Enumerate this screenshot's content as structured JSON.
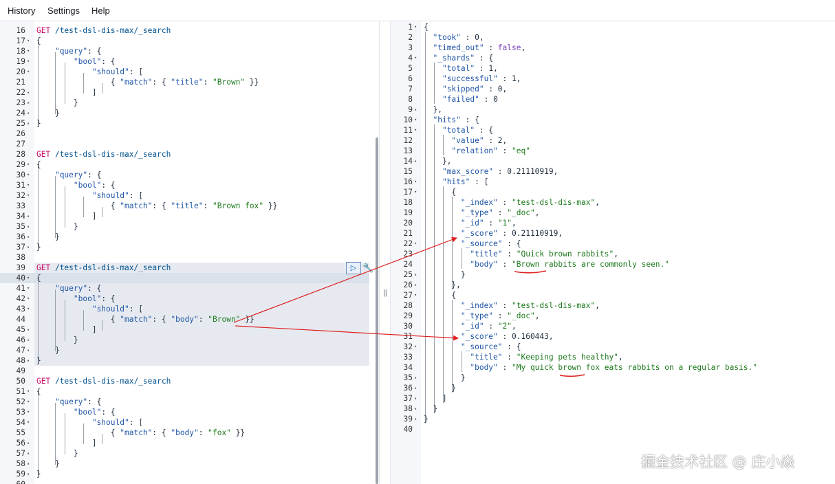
{
  "menu": [
    "History",
    "Settings",
    "Help"
  ],
  "request_lines": [
    [
      16,
      "",
      [
        [
          "GET ",
          "method"
        ],
        [
          "/test-dsl-dis-max/_search",
          "url"
        ]
      ]
    ],
    [
      17,
      "▾",
      [
        [
          "{",
          "punc"
        ]
      ]
    ],
    [
      18,
      "▾",
      [
        [
          "    ",
          "punc"
        ],
        [
          "\"query\"",
          "key"
        ],
        [
          ": {",
          "punc"
        ]
      ]
    ],
    [
      19,
      "▾",
      [
        [
          "        ",
          "punc"
        ],
        [
          "\"bool\"",
          "key"
        ],
        [
          ": {",
          "punc"
        ]
      ]
    ],
    [
      20,
      "▾",
      [
        [
          "            ",
          "punc"
        ],
        [
          "\"should\"",
          "key"
        ],
        [
          ": [",
          "punc"
        ]
      ]
    ],
    [
      21,
      "",
      [
        [
          "                { ",
          "punc"
        ],
        [
          "\"match\"",
          "key"
        ],
        [
          ": { ",
          "punc"
        ],
        [
          "\"title\"",
          "key"
        ],
        [
          ": ",
          "punc"
        ],
        [
          "\"Brown\"",
          "str"
        ],
        [
          " }}",
          "punc"
        ]
      ]
    ],
    [
      22,
      "▴",
      [
        [
          "            ]",
          "punc"
        ]
      ]
    ],
    [
      23,
      "▴",
      [
        [
          "        }",
          "punc"
        ]
      ]
    ],
    [
      24,
      "▴",
      [
        [
          "    }",
          "punc"
        ]
      ]
    ],
    [
      25,
      "▴",
      [
        [
          "}",
          "punc"
        ]
      ]
    ],
    [
      26,
      "",
      []
    ],
    [
      27,
      "",
      []
    ],
    [
      28,
      "",
      [
        [
          "GET ",
          "method"
        ],
        [
          "/test-dsl-dis-max/_search",
          "url"
        ]
      ]
    ],
    [
      29,
      "▾",
      [
        [
          "{",
          "punc"
        ]
      ]
    ],
    [
      30,
      "▾",
      [
        [
          "    ",
          "punc"
        ],
        [
          "\"query\"",
          "key"
        ],
        [
          ": {",
          "punc"
        ]
      ]
    ],
    [
      31,
      "▾",
      [
        [
          "        ",
          "punc"
        ],
        [
          "\"bool\"",
          "key"
        ],
        [
          ": {",
          "punc"
        ]
      ]
    ],
    [
      32,
      "▾",
      [
        [
          "            ",
          "punc"
        ],
        [
          "\"should\"",
          "key"
        ],
        [
          ": [",
          "punc"
        ]
      ]
    ],
    [
      33,
      "",
      [
        [
          "                { ",
          "punc"
        ],
        [
          "\"match\"",
          "key"
        ],
        [
          ": { ",
          "punc"
        ],
        [
          "\"title\"",
          "key"
        ],
        [
          ": ",
          "punc"
        ],
        [
          "\"Brown fox\"",
          "str"
        ],
        [
          " }}",
          "punc"
        ]
      ]
    ],
    [
      34,
      "▴",
      [
        [
          "            ]",
          "punc"
        ]
      ]
    ],
    [
      35,
      "▴",
      [
        [
          "        }",
          "punc"
        ]
      ]
    ],
    [
      36,
      "▴",
      [
        [
          "    }",
          "punc"
        ]
      ]
    ],
    [
      37,
      "▴",
      [
        [
          "}",
          "punc"
        ]
      ]
    ],
    [
      38,
      "",
      []
    ],
    [
      39,
      "",
      [
        [
          "GET ",
          "method"
        ],
        [
          "/test-dsl-dis-max/_search",
          "url"
        ]
      ]
    ],
    [
      40,
      "▾",
      [
        [
          "{",
          "punc"
        ]
      ]
    ],
    [
      41,
      "▾",
      [
        [
          "    ",
          "punc"
        ],
        [
          "\"query\"",
          "key"
        ],
        [
          ": {",
          "punc"
        ]
      ]
    ],
    [
      42,
      "▾",
      [
        [
          "        ",
          "punc"
        ],
        [
          "\"bool\"",
          "key"
        ],
        [
          ": {",
          "punc"
        ]
      ]
    ],
    [
      43,
      "▾",
      [
        [
          "            ",
          "punc"
        ],
        [
          "\"should\"",
          "key"
        ],
        [
          ": [",
          "punc"
        ]
      ]
    ],
    [
      44,
      "",
      [
        [
          "                { ",
          "punc"
        ],
        [
          "\"match\"",
          "key"
        ],
        [
          ": { ",
          "punc"
        ],
        [
          "\"body\"",
          "key"
        ],
        [
          ": ",
          "punc"
        ],
        [
          "\"Brown\"",
          "str"
        ],
        [
          " }}",
          "punc"
        ]
      ]
    ],
    [
      45,
      "▴",
      [
        [
          "            ]",
          "punc"
        ]
      ]
    ],
    [
      46,
      "▴",
      [
        [
          "        }",
          "punc"
        ]
      ]
    ],
    [
      47,
      "▴",
      [
        [
          "    }",
          "punc"
        ]
      ]
    ],
    [
      48,
      "▴",
      [
        [
          "}",
          "punc"
        ]
      ]
    ],
    [
      49,
      "",
      []
    ],
    [
      50,
      "",
      [
        [
          "GET ",
          "method"
        ],
        [
          "/test-dsl-dis-max/_search",
          "url"
        ]
      ]
    ],
    [
      51,
      "▾",
      [
        [
          "{",
          "punc"
        ]
      ]
    ],
    [
      52,
      "▾",
      [
        [
          "    ",
          "punc"
        ],
        [
          "\"query\"",
          "key"
        ],
        [
          ": {",
          "punc"
        ]
      ]
    ],
    [
      53,
      "▾",
      [
        [
          "        ",
          "punc"
        ],
        [
          "\"bool\"",
          "key"
        ],
        [
          ": {",
          "punc"
        ]
      ]
    ],
    [
      54,
      "▾",
      [
        [
          "            ",
          "punc"
        ],
        [
          "\"should\"",
          "key"
        ],
        [
          ": [",
          "punc"
        ]
      ]
    ],
    [
      55,
      "",
      [
        [
          "                { ",
          "punc"
        ],
        [
          "\"match\"",
          "key"
        ],
        [
          ": { ",
          "punc"
        ],
        [
          "\"body\"",
          "key"
        ],
        [
          ": ",
          "punc"
        ],
        [
          "\"fox\"",
          "str"
        ],
        [
          " }}",
          "punc"
        ]
      ]
    ],
    [
      56,
      "▴",
      [
        [
          "            ]",
          "punc"
        ]
      ]
    ],
    [
      57,
      "▴",
      [
        [
          "        }",
          "punc"
        ]
      ]
    ],
    [
      58,
      "▴",
      [
        [
          "    }",
          "punc"
        ]
      ]
    ],
    [
      59,
      "▴",
      [
        [
          "}",
          "punc"
        ]
      ]
    ],
    [
      60,
      "",
      []
    ]
  ],
  "response_lines": [
    [
      1,
      "▾",
      [
        [
          "{",
          "punc"
        ]
      ]
    ],
    [
      2,
      "",
      [
        [
          "  ",
          "punc"
        ],
        [
          "\"took\"",
          "key"
        ],
        [
          " : ",
          "punc"
        ],
        [
          "0",
          "num"
        ],
        [
          ",",
          "punc"
        ]
      ]
    ],
    [
      3,
      "",
      [
        [
          "  ",
          "punc"
        ],
        [
          "\"timed_out\"",
          "key"
        ],
        [
          " : ",
          "punc"
        ],
        [
          "false",
          "bool"
        ],
        [
          ",",
          "punc"
        ]
      ]
    ],
    [
      4,
      "▾",
      [
        [
          "  ",
          "punc"
        ],
        [
          "\"_shards\"",
          "key"
        ],
        [
          " : {",
          "punc"
        ]
      ]
    ],
    [
      5,
      "",
      [
        [
          "    ",
          "punc"
        ],
        [
          "\"total\"",
          "key"
        ],
        [
          " : ",
          "punc"
        ],
        [
          "1",
          "num"
        ],
        [
          ",",
          "punc"
        ]
      ]
    ],
    [
      6,
      "",
      [
        [
          "    ",
          "punc"
        ],
        [
          "\"successful\"",
          "key"
        ],
        [
          " : ",
          "punc"
        ],
        [
          "1",
          "num"
        ],
        [
          ",",
          "punc"
        ]
      ]
    ],
    [
      7,
      "",
      [
        [
          "    ",
          "punc"
        ],
        [
          "\"skipped\"",
          "key"
        ],
        [
          " : ",
          "punc"
        ],
        [
          "0",
          "num"
        ],
        [
          ",",
          "punc"
        ]
      ]
    ],
    [
      8,
      "",
      [
        [
          "    ",
          "punc"
        ],
        [
          "\"failed\"",
          "key"
        ],
        [
          " : ",
          "punc"
        ],
        [
          "0",
          "num"
        ]
      ]
    ],
    [
      9,
      "▴",
      [
        [
          "  },",
          "punc"
        ]
      ]
    ],
    [
      10,
      "▾",
      [
        [
          "  ",
          "punc"
        ],
        [
          "\"hits\"",
          "key"
        ],
        [
          " : {",
          "punc"
        ]
      ]
    ],
    [
      11,
      "▾",
      [
        [
          "    ",
          "punc"
        ],
        [
          "\"total\"",
          "key"
        ],
        [
          " : {",
          "punc"
        ]
      ]
    ],
    [
      12,
      "",
      [
        [
          "      ",
          "punc"
        ],
        [
          "\"value\"",
          "key"
        ],
        [
          " : ",
          "punc"
        ],
        [
          "2",
          "num"
        ],
        [
          ",",
          "punc"
        ]
      ]
    ],
    [
      13,
      "",
      [
        [
          "      ",
          "punc"
        ],
        [
          "\"relation\"",
          "key"
        ],
        [
          " : ",
          "punc"
        ],
        [
          "\"eq\"",
          "str"
        ]
      ]
    ],
    [
      14,
      "▴",
      [
        [
          "    },",
          "punc"
        ]
      ]
    ],
    [
      15,
      "",
      [
        [
          "    ",
          "punc"
        ],
        [
          "\"max_score\"",
          "key"
        ],
        [
          " : ",
          "punc"
        ],
        [
          "0.21110919",
          "num"
        ],
        [
          ",",
          "punc"
        ]
      ]
    ],
    [
      16,
      "▾",
      [
        [
          "    ",
          "punc"
        ],
        [
          "\"hits\"",
          "key"
        ],
        [
          " : [",
          "punc"
        ]
      ]
    ],
    [
      17,
      "▾",
      [
        [
          "      {",
          "punc"
        ]
      ]
    ],
    [
      18,
      "",
      [
        [
          "        ",
          "punc"
        ],
        [
          "\"_index\"",
          "key"
        ],
        [
          " : ",
          "punc"
        ],
        [
          "\"test-dsl-dis-max\"",
          "str"
        ],
        [
          ",",
          "punc"
        ]
      ]
    ],
    [
      19,
      "",
      [
        [
          "        ",
          "punc"
        ],
        [
          "\"_type\"",
          "key"
        ],
        [
          " : ",
          "punc"
        ],
        [
          "\"_doc\"",
          "str"
        ],
        [
          ",",
          "punc"
        ]
      ]
    ],
    [
      20,
      "",
      [
        [
          "        ",
          "punc"
        ],
        [
          "\"_id\"",
          "key"
        ],
        [
          " : ",
          "punc"
        ],
        [
          "\"1\"",
          "str"
        ],
        [
          ",",
          "punc"
        ]
      ]
    ],
    [
      21,
      "",
      [
        [
          "        ",
          "punc"
        ],
        [
          "\"_score\"",
          "key"
        ],
        [
          " : ",
          "punc"
        ],
        [
          "0.21110919",
          "num"
        ],
        [
          ",",
          "punc"
        ]
      ]
    ],
    [
      22,
      "▾",
      [
        [
          "        ",
          "punc"
        ],
        [
          "\"_source\"",
          "key"
        ],
        [
          " : {",
          "punc"
        ]
      ]
    ],
    [
      23,
      "",
      [
        [
          "          ",
          "punc"
        ],
        [
          "\"title\"",
          "key"
        ],
        [
          " : ",
          "punc"
        ],
        [
          "\"Quick brown rabbits\"",
          "str"
        ],
        [
          ",",
          "punc"
        ]
      ]
    ],
    [
      24,
      "",
      [
        [
          "          ",
          "punc"
        ],
        [
          "\"body\"",
          "key"
        ],
        [
          " : ",
          "punc"
        ],
        [
          "\"Brown rabbits are commonly seen.\"",
          "str"
        ]
      ]
    ],
    [
      25,
      "▴",
      [
        [
          "        }",
          "punc"
        ]
      ]
    ],
    [
      26,
      "▴",
      [
        [
          "      },",
          "punc"
        ]
      ]
    ],
    [
      27,
      "▾",
      [
        [
          "      {",
          "punc"
        ]
      ]
    ],
    [
      28,
      "",
      [
        [
          "        ",
          "punc"
        ],
        [
          "\"_index\"",
          "key"
        ],
        [
          " : ",
          "punc"
        ],
        [
          "\"test-dsl-dis-max\"",
          "str"
        ],
        [
          ",",
          "punc"
        ]
      ]
    ],
    [
      29,
      "",
      [
        [
          "        ",
          "punc"
        ],
        [
          "\"_type\"",
          "key"
        ],
        [
          " : ",
          "punc"
        ],
        [
          "\"_doc\"",
          "str"
        ],
        [
          ",",
          "punc"
        ]
      ]
    ],
    [
      30,
      "",
      [
        [
          "        ",
          "punc"
        ],
        [
          "\"_id\"",
          "key"
        ],
        [
          " : ",
          "punc"
        ],
        [
          "\"2\"",
          "str"
        ],
        [
          ",",
          "punc"
        ]
      ]
    ],
    [
      31,
      "",
      [
        [
          "        ",
          "punc"
        ],
        [
          "\"_score\"",
          "key"
        ],
        [
          " : ",
          "punc"
        ],
        [
          "0.160443",
          "num"
        ],
        [
          ",",
          "punc"
        ]
      ]
    ],
    [
      32,
      "▾",
      [
        [
          "        ",
          "punc"
        ],
        [
          "\"_source\"",
          "key"
        ],
        [
          " : {",
          "punc"
        ]
      ]
    ],
    [
      33,
      "",
      [
        [
          "          ",
          "punc"
        ],
        [
          "\"title\"",
          "key"
        ],
        [
          " : ",
          "punc"
        ],
        [
          "\"Keeping pets healthy\"",
          "str"
        ],
        [
          ",",
          "punc"
        ]
      ]
    ],
    [
      34,
      "",
      [
        [
          "          ",
          "punc"
        ],
        [
          "\"body\"",
          "key"
        ],
        [
          " : ",
          "punc"
        ],
        [
          "\"My quick brown fox eats rabbits on a regular basis.\"",
          "str"
        ]
      ]
    ],
    [
      35,
      "▴",
      [
        [
          "        }",
          "punc"
        ]
      ]
    ],
    [
      36,
      "▴",
      [
        [
          "      }",
          "punc"
        ]
      ]
    ],
    [
      37,
      "▴",
      [
        [
          "    ]",
          "punc"
        ]
      ]
    ],
    [
      38,
      "▴",
      [
        [
          "  }",
          "punc"
        ]
      ]
    ],
    [
      39,
      "▴",
      [
        [
          "}",
          "punc"
        ]
      ]
    ],
    [
      40,
      "",
      []
    ]
  ],
  "run_icon": "play-icon",
  "wrench_icon": "wrench-icon",
  "splitter_handle": "||",
  "watermark": "掘金技术社区 @ 庄小焱",
  "colors": {
    "method": "#c80a68",
    "url": "#00518f",
    "string": "#1e7a1e",
    "key": "#1f55a6",
    "annotation": "#e02020"
  }
}
